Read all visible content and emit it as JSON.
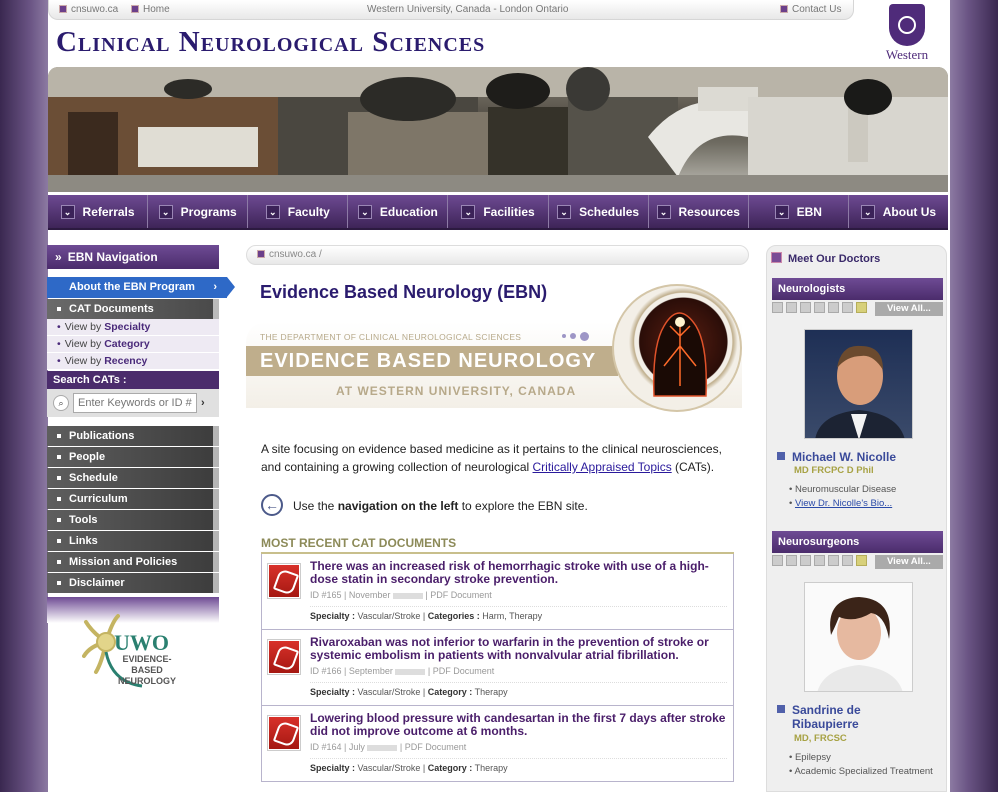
{
  "topbar": {
    "site_link": "cnsuwo.ca",
    "home_link": "Home",
    "center_text": "Western University, Canada - London Ontario",
    "contact_link": "Contact Us"
  },
  "header": {
    "title": "Clinical Neurological Sciences",
    "logo_label": "Western"
  },
  "nav": [
    "Referrals",
    "Programs",
    "Faculty",
    "Education",
    "Facilities",
    "Schedules",
    "Resources",
    "EBN",
    "About Us"
  ],
  "sidebar": {
    "heading": "EBN Navigation",
    "about": "About the EBN Program",
    "cat_documents": "CAT Documents",
    "view_by": [
      {
        "prefix": "View by",
        "label": "Specialty"
      },
      {
        "prefix": "View by",
        "label": "Category"
      },
      {
        "prefix": "View by",
        "label": "Recency"
      }
    ],
    "search_label": "Search CATs :",
    "search_placeholder": "Enter Keywords or ID #",
    "links": [
      "Publications",
      "People",
      "Schedule",
      "Curriculum",
      "Tools",
      "Links",
      "Mission and Policies",
      "Disclaimer"
    ],
    "logo_text": "UWO",
    "logo_sub1": "EVIDENCE-BASED",
    "logo_sub2": "NEUROLOGY"
  },
  "breadcrumb": "cnsuwo.ca /",
  "page_title": "Evidence Based Neurology (EBN)",
  "ebn_banner": {
    "dept": "THE DEPARTMENT OF CLINICAL NEUROLOGICAL SCIENCES",
    "title": "EVIDENCE BASED NEUROLOGY",
    "subtitle": "AT WESTERN UNIVERSITY, CANADA"
  },
  "intro": {
    "text_before": "A site focusing on evidence based medicine as it pertains to the clinical neurosciences, and containing a growing collection of neurological ",
    "link": "Critically Appraised Topics",
    "text_after": " (CATs)."
  },
  "nav_hint": {
    "before": "Use the ",
    "bold": "navigation on the left",
    "after": " to explore the EBN site."
  },
  "recent_heading": "Most Recent CAT Documents",
  "documents": [
    {
      "title": "There was an increased risk of hemorrhagic stroke with use of a high-dose statin in secondary stroke prevention.",
      "id": "ID #165",
      "month": "November",
      "type": "PDF Document",
      "specialty_label": "Specialty :",
      "specialty": "Vascular/Stroke",
      "category_label": "Categories :",
      "category": "Harm, Therapy"
    },
    {
      "title": "Rivaroxaban was not inferior to warfarin in the prevention of stroke or systemic embolism in patients with nonvalvular atrial fibrillation.",
      "id": "ID #166",
      "month": "September",
      "type": "PDF Document",
      "specialty_label": "Specialty :",
      "specialty": "Vascular/Stroke",
      "category_label": "Category :",
      "category": "Therapy"
    },
    {
      "title": "Lowering blood pressure with candesartan in the first 7 days after stroke did not improve outcome at 6 months.",
      "id": "ID #164",
      "month": "July",
      "type": "PDF Document",
      "specialty_label": "Specialty :",
      "specialty": "Vascular/Stroke",
      "category_label": "Category :",
      "category": "Therapy"
    }
  ],
  "doctors": {
    "heading": "Meet Our Doctors",
    "view_all": "View All...",
    "groups": [
      {
        "name": "Neurologists",
        "doctor": "Michael W. Nicolle",
        "title": "MD FRCPC D Phil",
        "items": [
          "Neuromuscular Disease"
        ],
        "link": "View Dr. Nicolle's Bio..."
      },
      {
        "name": "Neurosurgeons",
        "doctor_line1": "Sandrine de",
        "doctor_line2": "Ribaupierre",
        "title": "MD, FRCSC",
        "items": [
          "Epilepsy",
          "Academic Specialized Treatment"
        ]
      }
    ]
  },
  "colors": {
    "brand": "#4f2b7a",
    "accent": "#2e69c7",
    "gold": "#bfae8c"
  }
}
